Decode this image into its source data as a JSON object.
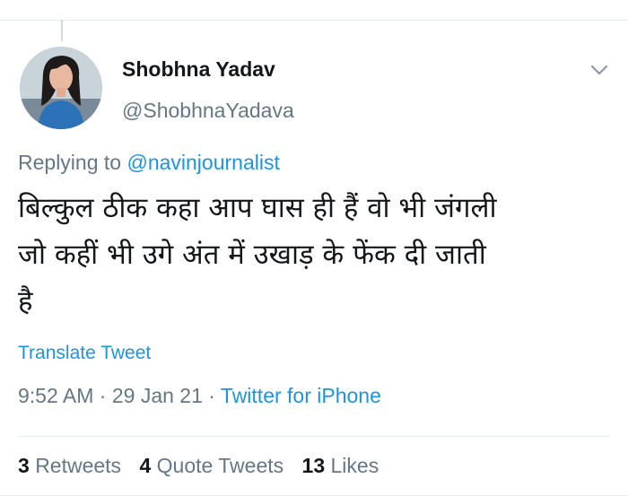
{
  "tweet": {
    "author": {
      "display_name": "Shobhna Yadav",
      "handle": "@ShobhnaYadava"
    },
    "replying_to_prefix": "Replying to",
    "replying_to_handle": "@navinjournalist",
    "text_lines": [
      "बिल्कुल ठीक कहा आप घास ही हैं  वो भी जंगली",
      "जो कहीं भी उगे अंत में उखाड़ के फेंक दी जाती",
      "है"
    ],
    "translate_label": "Translate Tweet",
    "time": "9:52 AM",
    "date": "29 Jan 21",
    "source": "Twitter for iPhone",
    "separator": "·",
    "stats": {
      "retweets_count": "3",
      "retweets_label": "Retweets",
      "quote_tweets_count": "4",
      "quote_tweets_label": "Quote Tweets",
      "likes_count": "13",
      "likes_label": "Likes"
    }
  },
  "icons": {
    "more": "chevron-down-icon",
    "avatar": "avatar"
  },
  "colors": {
    "link": "#1b95e0",
    "secondary_text": "#657786",
    "primary_text": "#14171a",
    "divider": "#e6ecf0"
  }
}
